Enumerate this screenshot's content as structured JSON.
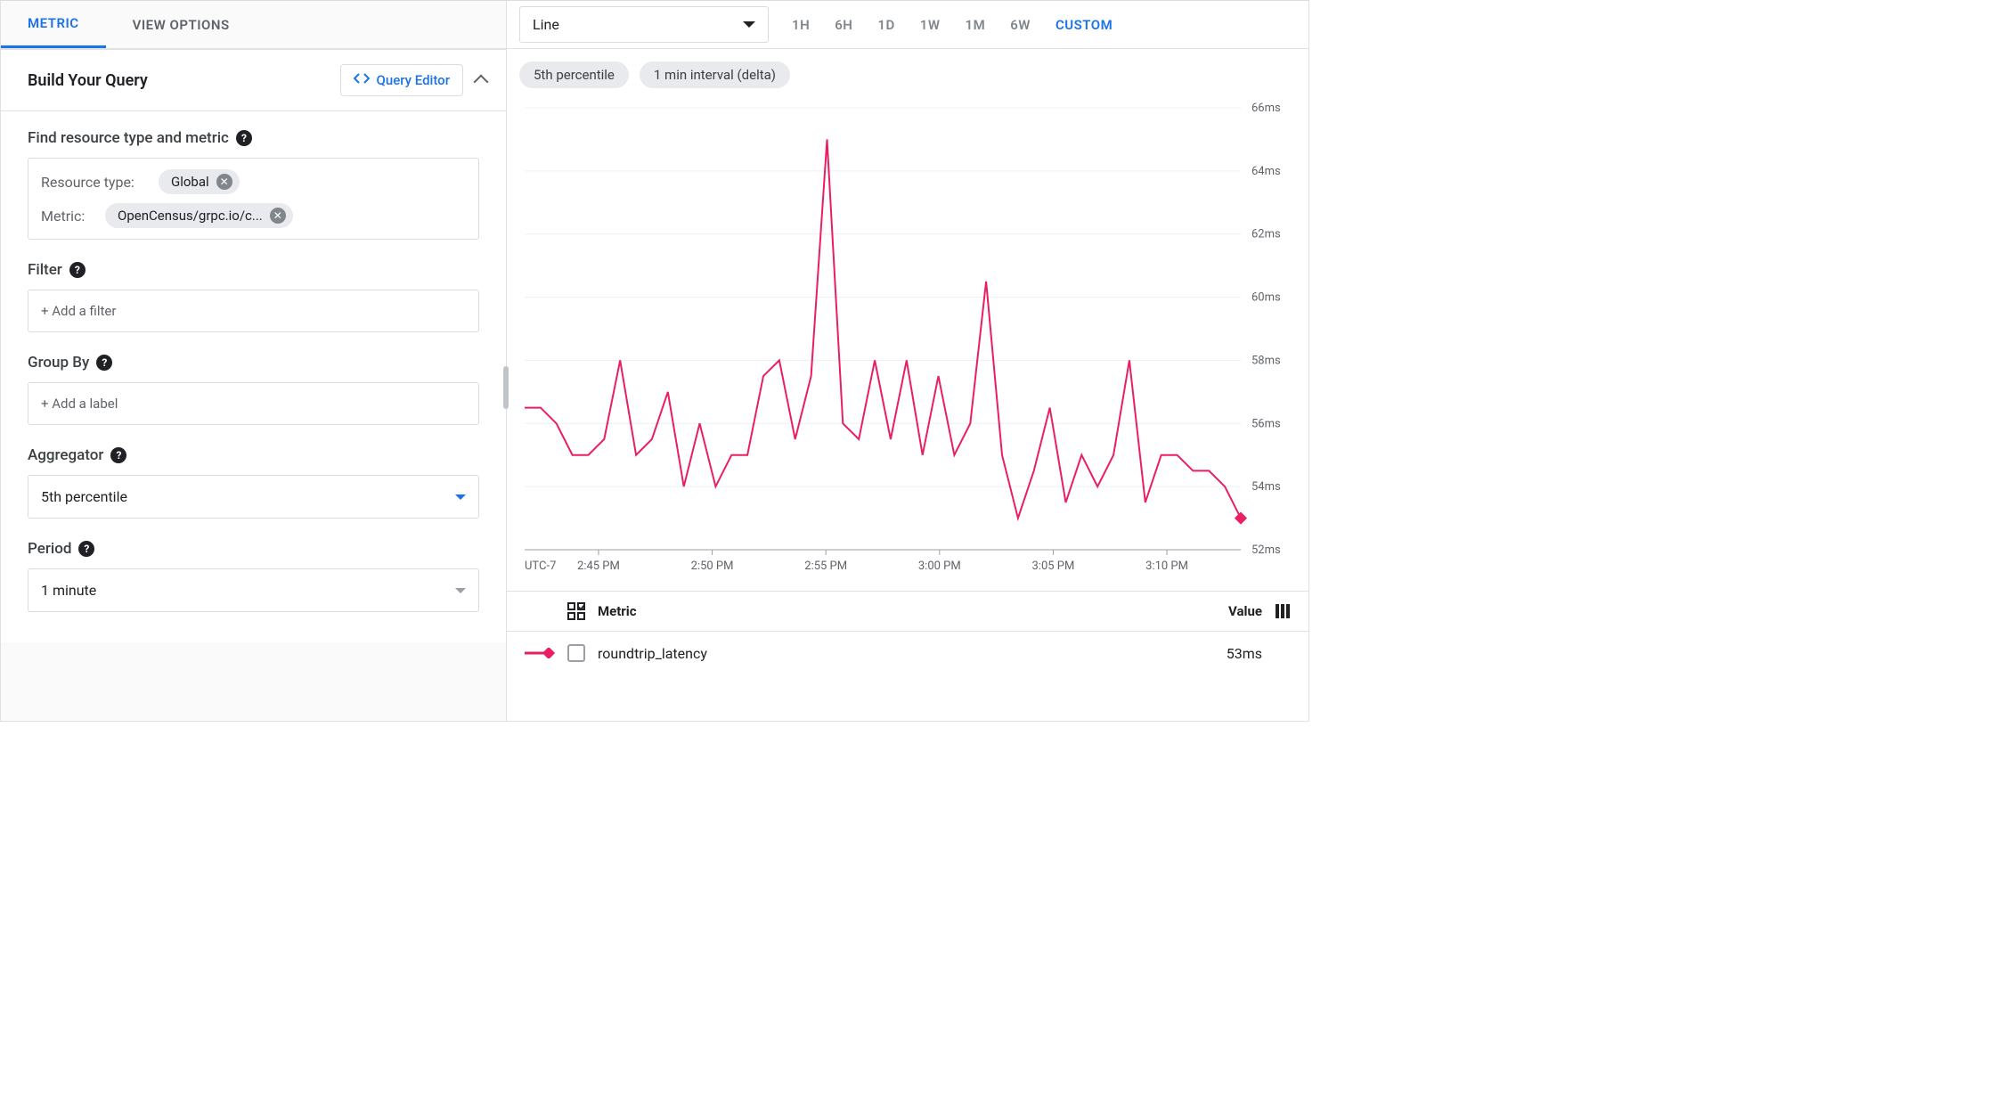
{
  "tabs": {
    "metric": "METRIC",
    "view_options": "VIEW OPTIONS"
  },
  "section": {
    "title": "Build Your Query",
    "query_editor": "Query Editor"
  },
  "find": {
    "label": "Find resource type and metric",
    "resource_type_key": "Resource type:",
    "resource_type_value": "Global",
    "metric_key": "Metric:",
    "metric_value": "OpenCensus/grpc.io/c..."
  },
  "filter": {
    "label": "Filter",
    "placeholder": "+ Add a filter"
  },
  "group_by": {
    "label": "Group By",
    "placeholder": "+ Add a label"
  },
  "aggregator": {
    "label": "Aggregator",
    "value": "5th percentile"
  },
  "period": {
    "label": "Period",
    "value": "1 minute"
  },
  "chart_type": {
    "value": "Line"
  },
  "ranges": {
    "r0": "1H",
    "r1": "6H",
    "r2": "1D",
    "r3": "1W",
    "r4": "1M",
    "r5": "6W",
    "custom": "CUSTOM"
  },
  "badges": {
    "b0": "5th percentile",
    "b1": "1 min interval (delta)"
  },
  "chart_data": {
    "type": "line",
    "title": "",
    "xlabel": "",
    "ylabel": "",
    "ylim": [
      52,
      66
    ],
    "y_ticks": [
      "66ms",
      "64ms",
      "62ms",
      "60ms",
      "58ms",
      "56ms",
      "54ms",
      "52ms"
    ],
    "timezone": "UTC-7",
    "x_ticks": [
      "2:45 PM",
      "2:50 PM",
      "2:55 PM",
      "3:00 PM",
      "3:05 PM",
      "3:10 PM"
    ],
    "series": [
      {
        "name": "roundtrip_latency",
        "color": "#e91e63",
        "values": [
          56.5,
          56.5,
          56.0,
          55.0,
          55.0,
          55.5,
          58.0,
          55.0,
          55.5,
          57.0,
          54.0,
          56.0,
          54.0,
          55.0,
          55.0,
          57.5,
          58.0,
          55.5,
          57.5,
          65.0,
          56.0,
          55.5,
          58.0,
          55.5,
          58.0,
          55.0,
          57.5,
          55.0,
          56.0,
          60.5,
          55.0,
          53.0,
          54.5,
          56.5,
          53.5,
          55.0,
          54.0,
          55.0,
          58.0,
          53.5,
          55.0,
          55.0,
          54.5,
          54.5,
          54.0,
          53.0
        ]
      }
    ]
  },
  "legend": {
    "metric_col": "Metric",
    "value_col": "Value",
    "row0_name": "roundtrip_latency",
    "row0_value": "53ms"
  }
}
